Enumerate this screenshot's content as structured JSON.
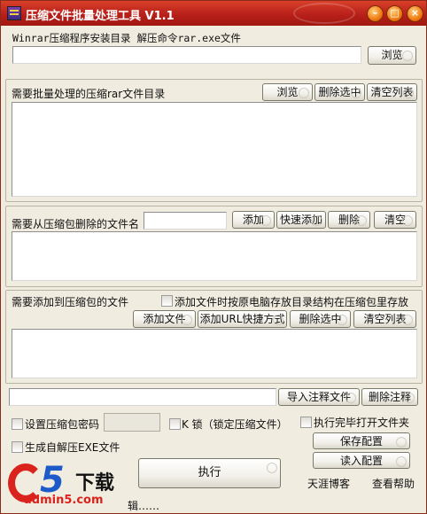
{
  "window": {
    "title": "压缩文件批量处理工具 V1.1"
  },
  "winrar": {
    "label": "Winrar压缩程序安装目录 解压命令rar.exe文件",
    "path_value": "",
    "browse_label": "浏览"
  },
  "batch_dir": {
    "label": "需要批量处理的压缩rar文件目录",
    "browse_label": "浏览",
    "delete_selected_label": "删除选中",
    "clear_list_label": "清空列表"
  },
  "delete_files": {
    "label": "需要从压缩包删除的文件名",
    "filename_value": "",
    "add_label": "添加",
    "quick_add_label": "快速添加",
    "delete_label": "删除",
    "clear_label": "清空"
  },
  "add_files": {
    "label": "需要添加到压缩包的文件",
    "keep_structure_label": "添加文件时按原电脑存放目录结构在压缩包里存放",
    "add_file_label": "添加文件",
    "add_url_label": "添加URL快捷方式",
    "delete_selected_label": "删除选中",
    "clear_list_label": "清空列表"
  },
  "comment": {
    "value": "",
    "import_label": "导入注释文件",
    "delete_label": "删除注释"
  },
  "options": {
    "set_password_label": "设置压缩包密码",
    "password_value": "",
    "k_lock_label": "K 锁（锁定压缩文件）",
    "open_folder_label": "执行完毕打开文件夹",
    "self_extract_label": "生成自解压EXE文件"
  },
  "actions": {
    "save_config_label": "保存配置",
    "load_config_label": "读入配置",
    "execute_label": "执行"
  },
  "footer": {
    "blog_link": "天涯博客",
    "help_link": "查看帮助",
    "status_text": "辑……"
  },
  "watermark": {
    "logo_text": "a5下载",
    "url": "admin5.com"
  },
  "colors": {
    "titlebar": "#b8201a",
    "window_bg": "#f0ece0",
    "logo_red": "#d9231c",
    "logo_blue": "#1c5bc8"
  }
}
